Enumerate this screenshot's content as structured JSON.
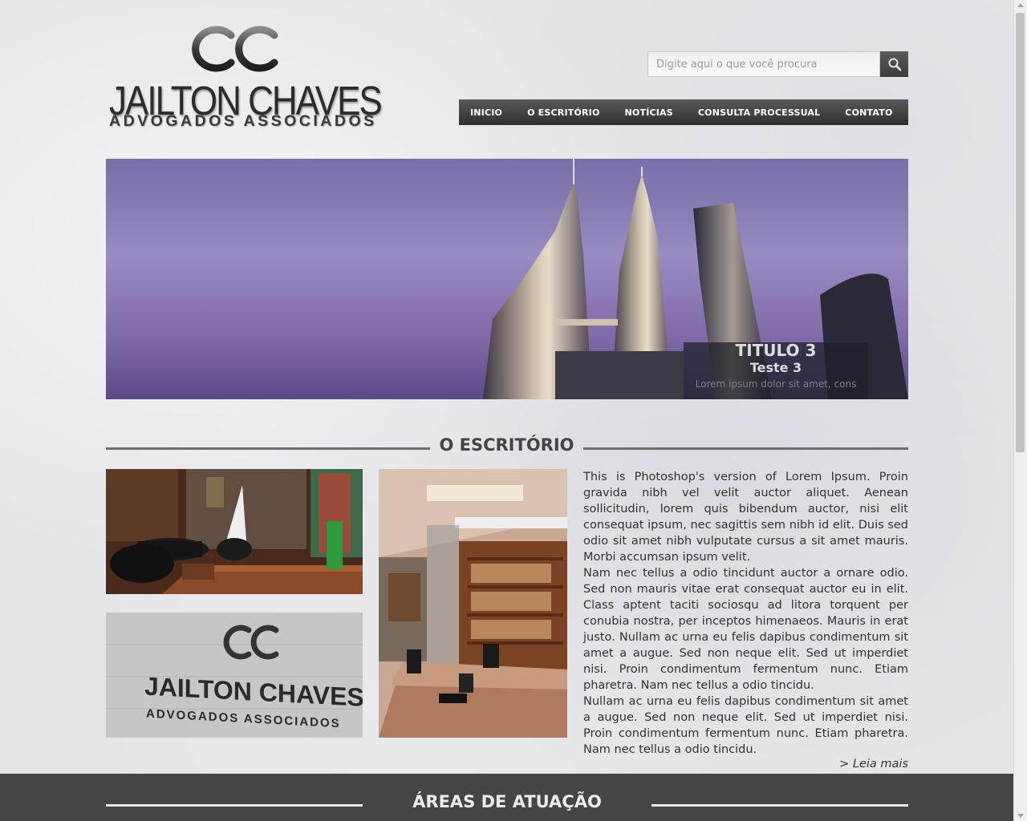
{
  "brand": {
    "monogram": "CC",
    "name": "JAILTON CHAVES",
    "tagline": "ADVOGADOS ASSOCIADOS"
  },
  "search": {
    "placeholder": "Digite aqui o que você procura",
    "icon": "search-icon"
  },
  "nav": {
    "items": [
      {
        "label": "INICIO"
      },
      {
        "label": "O ESCRITÓRIO"
      },
      {
        "label": "NOTÍCIAS"
      },
      {
        "label": "CONSULTA PROCESSUAL"
      },
      {
        "label": "CONTATO"
      }
    ]
  },
  "banner": {
    "title": "TÍTULO 3",
    "subtitle": "Teste 3",
    "text": "Lorem ipsum dolor sit amet, cons"
  },
  "office": {
    "title": "O ESCRITÓRIO",
    "paragraphs": [
      "This is Photoshop's version of Lorem Ipsum. Proin gravida nibh vel velit auctor aliquet. Aenean sollicitudin, lorem quis bibendum auctor, nisi elit consequat ipsum, nec sagittis sem nibh id elit. Duis sed odio sit amet nibh vulputate cursus a sit amet mauris. Morbi accumsan ipsum velit.",
      "Nam nec tellus a odio tincidunt auctor a ornare odio. Sed non mauris vitae erat consequat auctor eu in elit. Class aptent taciti sociosqu ad litora torquent per conubia nostra, per inceptos himenaeos. Mauris in erat justo. Nullam ac urna eu felis dapibus condimentum sit amet a augue. Sed non neque elit. Sed ut imperdiet nisi. Proin condimentum fermentum nunc. Etiam pharetra. Nam nec tellus a odio tincidu.",
      "Nullam ac urna eu felis dapibus condimentum sit amet a augue. Sed non neque elit. Sed ut imperdiet nisi. Proin condimentum fermentum nunc. Etiam pharetra. Nam nec tellus a odio tincidu."
    ],
    "read_more": "> Leia mais",
    "sign_text": "JAILTON CHAVES",
    "sign_sub": "ADVOGADOS ASSOCIADOS"
  },
  "areas": {
    "title": "ÁREAS DE ATUAÇÃO"
  },
  "colors": {
    "nav_bg": "#3a3a3a",
    "footer_bg": "#454548",
    "banner_sky": "#8a7fb5"
  }
}
